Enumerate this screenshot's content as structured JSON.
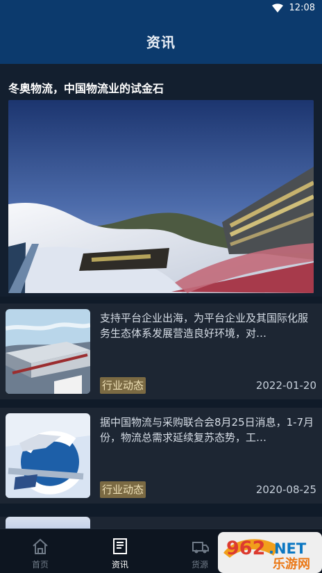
{
  "status_bar": {
    "time": "12:08",
    "wifi_icon": "wifi-icon"
  },
  "header": {
    "title": "资讯"
  },
  "feature": {
    "title": "冬奥物流，中国物流业的试金石"
  },
  "news": [
    {
      "summary": "支持平台企业出海，为平台企业及其国际化服务生态体系发展营造良好环境，对…",
      "tag": "行业动态",
      "date": "2022-01-20"
    },
    {
      "summary": "据中国物流与采购联合会8月25日消息，1-7月份，物流总需求延续复苏态势，工…",
      "tag": "行业动态",
      "date": "2020-08-25"
    }
  ],
  "bottom_nav": {
    "items": [
      {
        "label": "首页",
        "icon": "home-icon",
        "active": false
      },
      {
        "label": "资讯",
        "icon": "news-icon",
        "active": true
      },
      {
        "label": "货源",
        "icon": "truck-icon",
        "active": false
      }
    ]
  },
  "brand": {
    "badge": "962",
    "net": ".NET",
    "tagline": "乐游网"
  },
  "colors": {
    "header": "#0c3a6d",
    "background": "#101b29",
    "card": "#1d2633",
    "tag": "#7b6a43",
    "active": "#ffffff",
    "inactive": "#707b88"
  }
}
